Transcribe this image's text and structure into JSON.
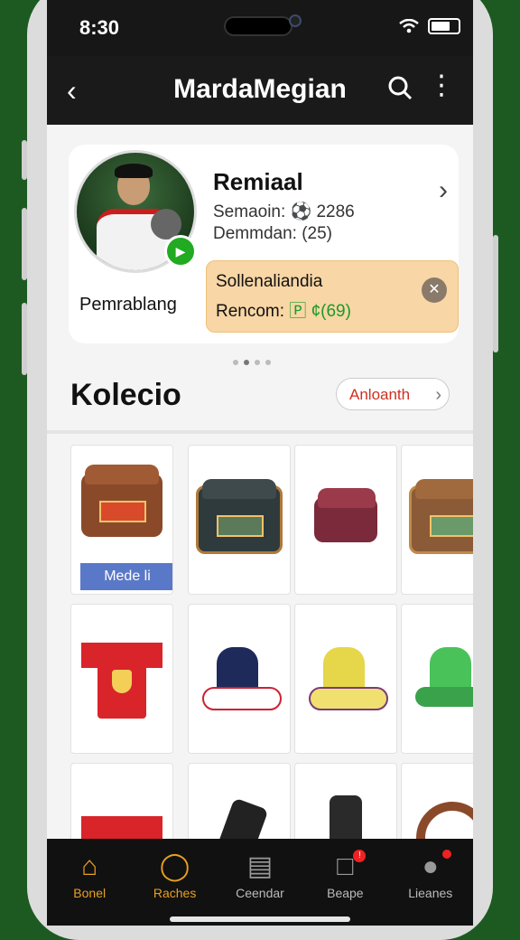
{
  "status": {
    "time": "8:30"
  },
  "appbar": {
    "title": "MardaMegian"
  },
  "profile": {
    "under_avatar_label": "Pemrablang",
    "name": "Remiaal",
    "stat1": "Semaoin: ⚽ 2286",
    "stat2": "Demmdan: (25)"
  },
  "reward": {
    "line1": "Sollenaliandia",
    "line2_prefix": "Rencom:",
    "line2_value": "🄿 ¢(69)"
  },
  "collection": {
    "title": "Kolecio",
    "all_button": "Anloanth",
    "items": [
      {
        "kind": "bag",
        "color": "#8a4a2a",
        "label": "Mede li"
      },
      {
        "kind": "bag",
        "color": "#2f3a3c"
      },
      {
        "kind": "bag",
        "color": "#7a2a3a"
      },
      {
        "kind": "bag",
        "color": "#8b5a36"
      },
      {
        "kind": "jersey",
        "color": "#d9242a"
      },
      {
        "kind": "boot",
        "color": "#1e2a5a"
      },
      {
        "kind": "boot",
        "color": "#e6d64a"
      },
      {
        "kind": "boot",
        "color": "#4ac25a"
      }
    ]
  },
  "bottom_nav": [
    {
      "label": "Bonel",
      "icon": "home-icon",
      "active": true
    },
    {
      "label": "Raches",
      "icon": "shield-icon",
      "active": false
    },
    {
      "label": "Ceendar",
      "icon": "shop-icon",
      "active": false
    },
    {
      "label": "Beape",
      "icon": "chat-icon",
      "active": false
    },
    {
      "label": "Lieanes",
      "icon": "people-icon",
      "active": false
    }
  ]
}
